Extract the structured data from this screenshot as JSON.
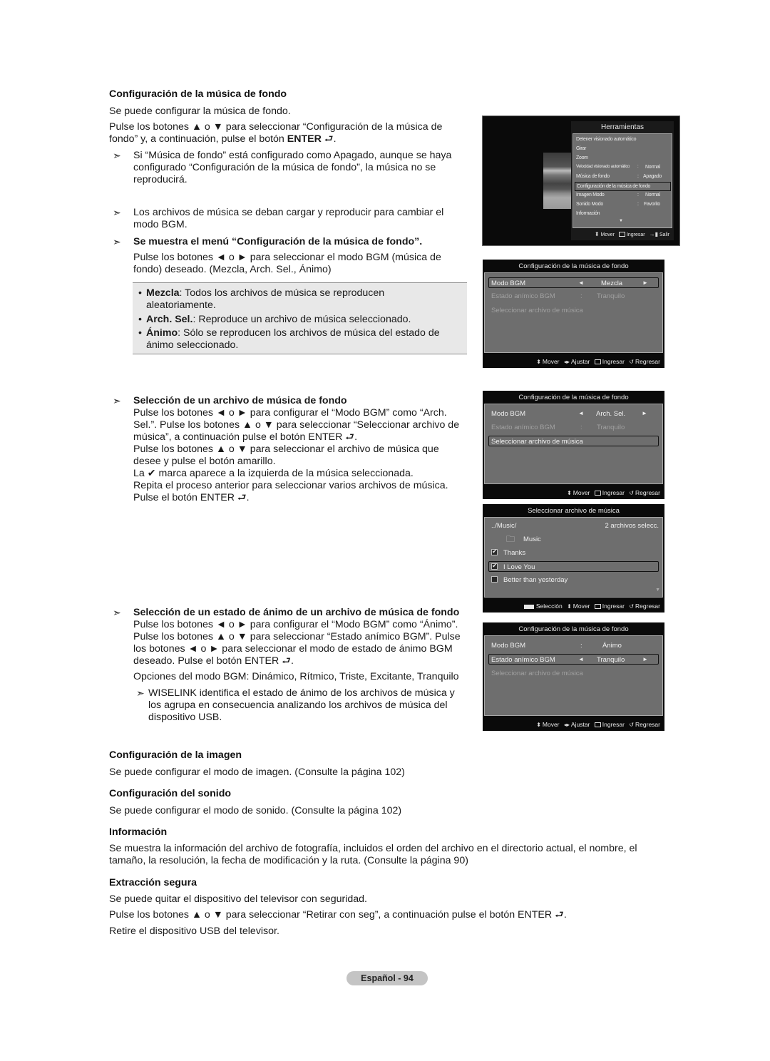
{
  "section_bgm": {
    "heading": "Configuración de la música de fondo",
    "intro": "Se puede configurar la música de fondo.",
    "instr_line1": "Pulse los botones ▲ o ▼ para seleccionar “Configuración de la música de",
    "instr_line2_pre": "fondo” y, a continuación, pulse el botón ",
    "enter_label": "ENTER",
    "enter_glyph": "⮐",
    "note1_lines": [
      "Si “Música de fondo” está configurado como Apagado, aunque se haya",
      "configurado “Configuración de la música de fondo”, la música no se",
      "reproducirá."
    ],
    "note2_lines": [
      "Los archivos de música se deban cargar y reproducir para cambiar el",
      "modo BGM."
    ],
    "note3_heading": "Se muestra el menú “Configuración de la música de fondo”.",
    "note3_lines": [
      "Pulse los botones ◄ o ► para seleccionar el modo BGM (música de",
      "fondo) deseado. (Mezcla, Arch. Sel., Ánimo)"
    ],
    "arrow_glyph": "➣",
    "bullets": [
      {
        "term": "Mezcla",
        "lines": [
          ": Todos los archivos de música se reproducen",
          "aleatoriamente."
        ]
      },
      {
        "term": "Arch. Sel.",
        "lines": [
          ": Reproduce un archivo de música seleccionado."
        ]
      },
      {
        "term": "Ánimo",
        "lines": [
          ": Sólo se reproducen los archivos de música del estado de",
          "ánimo seleccionado."
        ]
      }
    ]
  },
  "section_file": {
    "heading": "Selección de un archivo de música de fondo",
    "lines": [
      "Pulse los botones ◄ o ► para configurar el “Modo BGM” como “Arch.",
      "Sel.”. Pulse los botones ▲ o ▼ para seleccionar “Seleccionar archivo de",
      "música”, a continuación pulse el botón ENTER ⮐.",
      "Pulse los botones ▲ o ▼ para seleccionar el archivo de música que",
      "desee y pulse el botón amarillo.",
      "La ✔ marca aparece a la izquierda de la música seleccionada.",
      "Repita el proceso anterior para seleccionar varios archivos de música.",
      "Pulse el botón ENTER ⮐."
    ]
  },
  "section_mood": {
    "heading": "Selección de un estado de ánimo de un archivo de música de fondo",
    "lines": [
      "Pulse los botones ◄ o ► para configurar el “Modo BGM” como “Ánimo”.",
      "Pulse los botones ▲ o ▼ para seleccionar “Estado anímico BGM”. Pulse",
      "los botones ◄ o ► para seleccionar el modo de estado de ánimo BGM",
      "deseado. Pulse el botón ENTER ⮐."
    ],
    "options": "Opciones del modo BGM: Dinámico, Rítmico, Triste, Excitante, Tranquilo",
    "subnote_lines": [
      "WISELINK identifica el estado de ánimo de los archivos de música y",
      "los agrupa en consecuencia analizando los archivos de música del",
      "dispositivo USB."
    ]
  },
  "section_image": {
    "heading": "Configuración de la imagen",
    "text": "Se puede configurar el modo de imagen. (Consulte la página 102)"
  },
  "section_sound": {
    "heading": "Configuración del sonido",
    "text": "Se puede configurar el modo de sonido. (Consulte la página 102)"
  },
  "section_info": {
    "heading": "Información",
    "lines": [
      "Se muestra la información del archivo de fotografía, incluidos el orden del archivo en el directorio actual, el nombre, el",
      "tamaño, la resolución, la fecha de modificación y la ruta. (Consulte la página 90)"
    ]
  },
  "section_safe": {
    "heading": "Extracción segura",
    "line1": "Se puede quitar el dispositivo del televisor con seguridad.",
    "line2": "Pulse los botones ▲ o ▼ para seleccionar “Retirar con seg”, a continuación pulse el botón ENTER ⮐.",
    "line3": "Retire el dispositivo USB del televisor."
  },
  "tools_menu": {
    "title": "Herramientas",
    "items": [
      {
        "label": "Detener visionado automático",
        "sep": "",
        "value": ""
      },
      {
        "label": "Girar",
        "sep": "",
        "value": ""
      },
      {
        "label": "Zoom",
        "sep": "",
        "value": ""
      },
      {
        "label": "Velocidad visionado automático",
        "sep": ":",
        "value": "Normal"
      },
      {
        "label": "Música de fondo",
        "sep": ":",
        "value": "Apagado"
      },
      {
        "label": "Configuración de la música de fondo",
        "sep": "",
        "value": ""
      },
      {
        "label": "Imagen Modo",
        "sep": ":",
        "value": "Normal"
      },
      {
        "label": "Sonido Modo",
        "sep": ":",
        "value": "Favorito"
      },
      {
        "label": "Información",
        "sep": "",
        "value": ""
      }
    ],
    "selected_index": 5,
    "more_glyph": "▼",
    "footer": {
      "move": "Mover",
      "enter": "Ingresar",
      "exit": "Salir"
    }
  },
  "bgm_menu_1": {
    "title": "Configuración de la música de fondo",
    "rows": [
      {
        "label": "Modo BGM",
        "left": "◄",
        "value": "Mezcla",
        "right": "►"
      },
      {
        "label": "Estado anímico BGM",
        "sep": ":",
        "value": "Tranquilo"
      },
      {
        "label": "Seleccionar archivo de música"
      }
    ],
    "footer": {
      "move": "Mover",
      "adjust": "Ajustar",
      "enter": "Ingresar",
      "back": "Regresar"
    }
  },
  "bgm_menu_2": {
    "title": "Configuración de la música de fondo",
    "rows": [
      {
        "label": "Modo BGM",
        "left": "◄",
        "value": "Arch. Sel.",
        "right": "►"
      },
      {
        "label": "Estado anímico BGM",
        "sep": ":",
        "value": "Tranquilo"
      },
      {
        "label": "Seleccionar archivo de música"
      }
    ],
    "footer": {
      "move": "Mover",
      "enter": "Ingresar",
      "back": "Regresar"
    }
  },
  "file_menu": {
    "title": "Seleccionar archivo de música",
    "path": "../Music/",
    "count": "2 archivos selecc.",
    "folder": "Music",
    "files": [
      {
        "name": "Thanks",
        "checked": true
      },
      {
        "name": "I Love You",
        "checked": true
      },
      {
        "name": "Better than yesterday",
        "checked": false
      }
    ],
    "more_glyph": "▼",
    "footer": {
      "select": "Selección",
      "move": "Mover",
      "enter": "Ingresar",
      "back": "Regresar"
    }
  },
  "bgm_menu_3": {
    "title": "Configuración de la música de fondo",
    "rows": [
      {
        "label": "Modo BGM",
        "sep": ":",
        "value": "Ánimo"
      },
      {
        "label": "Estado anímico BGM",
        "left": "◄",
        "value": "Tranquilo",
        "right": "►"
      },
      {
        "label": "Seleccionar archivo de música"
      }
    ],
    "footer": {
      "move": "Mover",
      "adjust": "Ajustar",
      "enter": "Ingresar",
      "back": "Regresar"
    }
  },
  "footer": {
    "page_label": "Español - 94"
  }
}
